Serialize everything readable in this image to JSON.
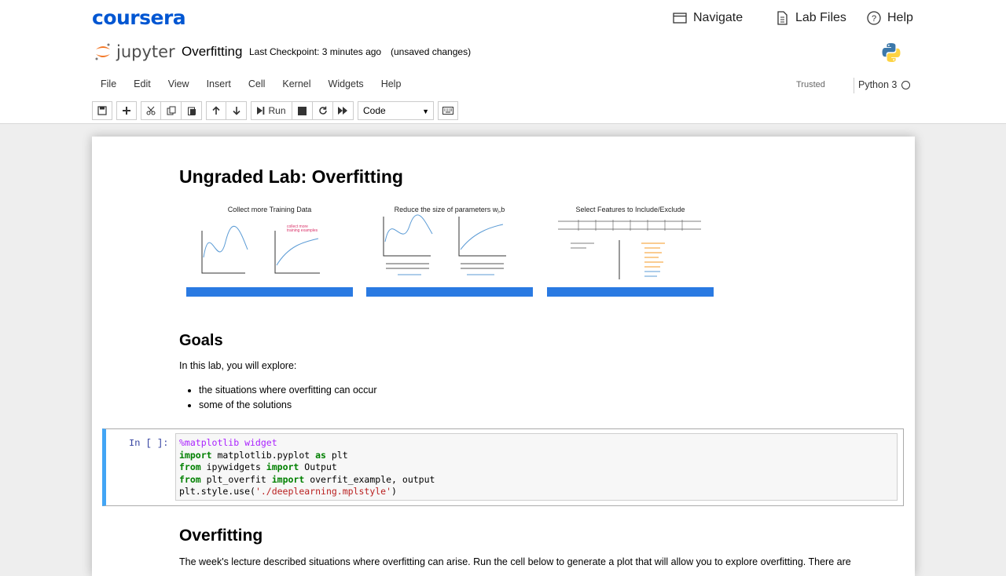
{
  "coursera": {
    "logo": "coursera",
    "nav": [
      {
        "label": "Navigate",
        "icon": "navigate-icon"
      },
      {
        "label": "Lab Files",
        "icon": "file-icon"
      },
      {
        "label": "Help",
        "icon": "help-icon"
      }
    ]
  },
  "jupyter": {
    "logo_text": "jupyter",
    "notebook_title": "Overfitting",
    "checkpoint": "Last Checkpoint: 3 minutes ago",
    "status": "(unsaved changes)",
    "menu": [
      "File",
      "Edit",
      "View",
      "Insert",
      "Cell",
      "Kernel",
      "Widgets",
      "Help"
    ],
    "trusted": "Trusted",
    "kernel": "Python 3",
    "toolbar": {
      "run_label": "Run",
      "cell_type": "Code"
    }
  },
  "notebook": {
    "title": "Ungraded Lab: Overfitting",
    "slides": [
      {
        "title": "Collect more Training Data"
      },
      {
        "title": "Reduce the size of parameters wⱼ,b"
      },
      {
        "title": "Select Features to Include/Exclude"
      }
    ],
    "goals_heading": "Goals",
    "goals_intro": "In this lab, you will explore:",
    "goals": [
      "the situations where overfitting can occur",
      "some of the solutions"
    ],
    "code_cell": {
      "prompt": "In [ ]:",
      "lines": [
        "%matplotlib widget",
        "import matplotlib.pyplot as plt",
        "from ipywidgets import Output",
        "from plt_overfit import overfit_example, output",
        "plt.style.use('./deeplearning.mplstyle')"
      ]
    },
    "section_heading": "Overfitting",
    "section_text": "The week's lecture described situations where overfitting can arise. Run the cell below to generate a plot that will allow you to explore overfitting. There are"
  },
  "colors": {
    "coursera_blue": "#0056d2",
    "cell_selected": "#42a5f5",
    "slide_footer": "#2a7ae2"
  }
}
